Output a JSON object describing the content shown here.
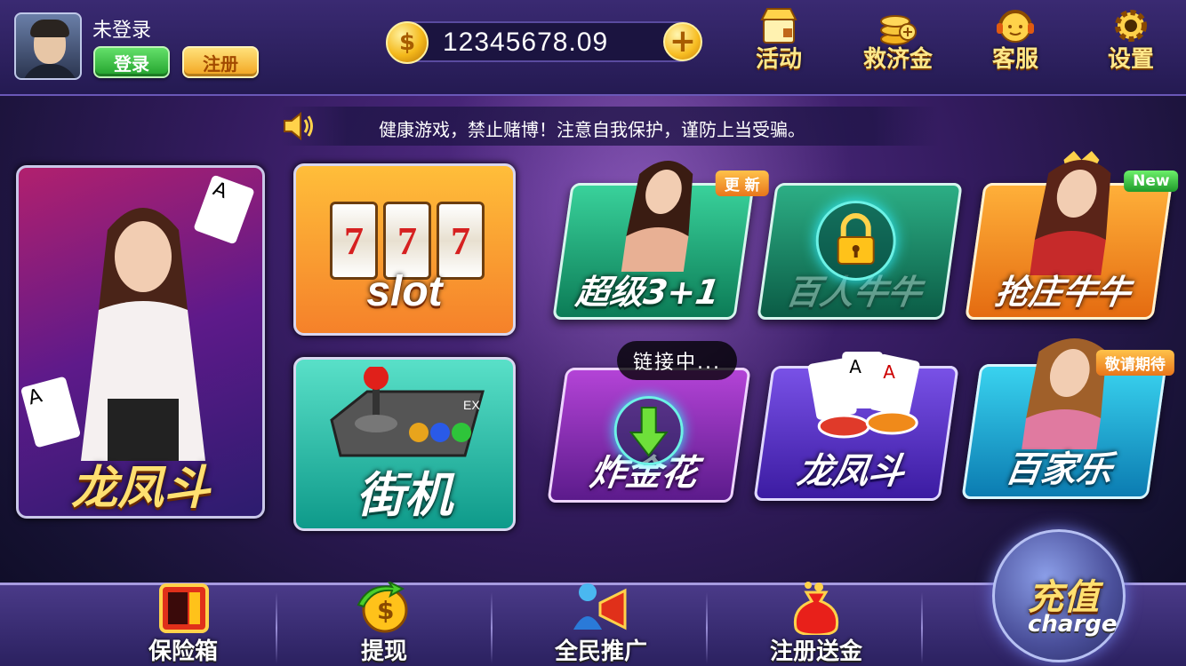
{
  "user": {
    "name": "未登录",
    "login_label": "登录",
    "register_label": "注册"
  },
  "wallet": {
    "balance": "12345678.09",
    "coin_symbol": "$",
    "add_symbol": "+"
  },
  "top_menu": [
    {
      "label": "活动",
      "icon": "shop-icon"
    },
    {
      "label": "救济金",
      "icon": "coin-stack-icon"
    },
    {
      "label": "客服",
      "icon": "headset-icon"
    },
    {
      "label": "设置",
      "icon": "gear-icon"
    }
  ],
  "notice": "健康游戏，禁止赌博！注意自我保护，谨防上当受骗。",
  "games": {
    "featured": {
      "title": "龙凤斗"
    },
    "slot": {
      "title": "slot",
      "reel": "7"
    },
    "arcade": {
      "title": "街机",
      "tag": "EX"
    },
    "chaoji": {
      "title": "超级3+1",
      "badge": "更 新"
    },
    "bairen": {
      "title": "百人牛牛",
      "locked": true
    },
    "qiangzhuang": {
      "title": "抢庄牛牛",
      "badge": "New"
    },
    "zhajinhua": {
      "title": "炸金花",
      "downloading": true
    },
    "longfengdou": {
      "title": "龙凤斗"
    },
    "baijiale": {
      "title": "百家乐",
      "badge": "敬请期待"
    }
  },
  "status": {
    "connecting": "链接中..."
  },
  "bottom_nav": [
    {
      "label": "保险箱",
      "icon": "safe-icon"
    },
    {
      "label": "提现",
      "icon": "withdraw-icon"
    },
    {
      "label": "全民推广",
      "icon": "megaphone-icon"
    },
    {
      "label": "注册送金",
      "icon": "money-bag-icon"
    }
  ],
  "charge": {
    "label_cn": "充值",
    "label_en": "charge"
  },
  "colors": {
    "accent_gold": "#ffe070",
    "bg_purple": "#331b5e"
  }
}
